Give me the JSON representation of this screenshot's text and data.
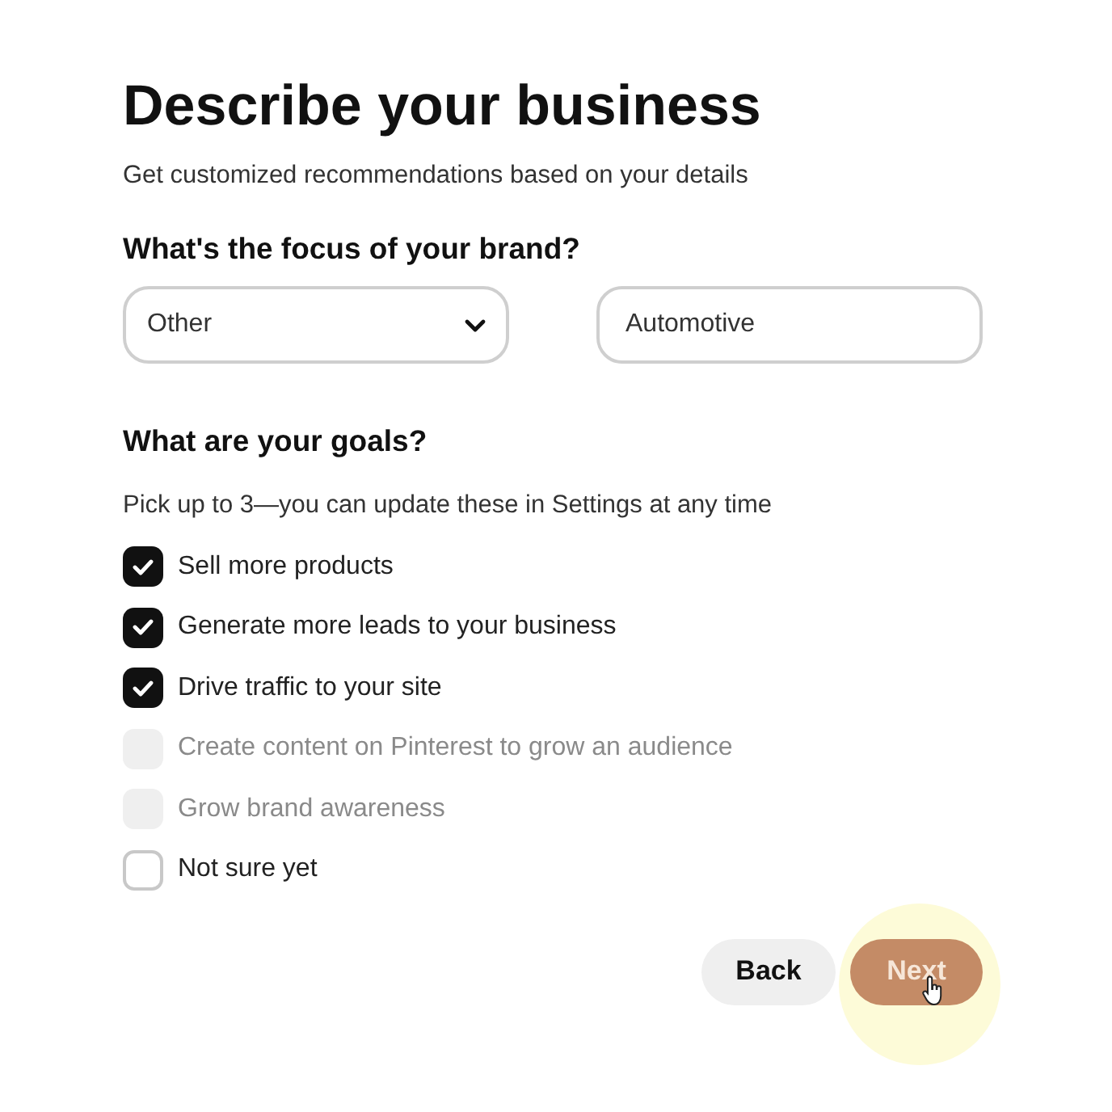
{
  "title": "Describe your business",
  "subtitle": "Get customized recommendations based on your details",
  "focus": {
    "heading": "What's the focus of your brand?",
    "fields": [
      {
        "kind": "dropdown",
        "value": "Other"
      },
      {
        "kind": "text",
        "value": "Automotive"
      }
    ]
  },
  "goals": {
    "heading": "What are your goals?",
    "hint": "Pick up to 3—you can update these in Settings at any time",
    "options": [
      {
        "label": "Sell more products",
        "checked": true,
        "disabled": false
      },
      {
        "label": "Generate more leads to your business",
        "checked": true,
        "disabled": false
      },
      {
        "label": "Drive traffic to your site",
        "checked": true,
        "disabled": false
      },
      {
        "label": "Create content on Pinterest to grow an audience",
        "checked": false,
        "disabled": true
      },
      {
        "label": "Grow brand awareness",
        "checked": false,
        "disabled": true
      },
      {
        "label": "Not sure yet",
        "checked": false,
        "disabled": false
      }
    ]
  },
  "buttons": [
    {
      "kind": "secondary",
      "label": "Back"
    },
    {
      "kind": "primary",
      "label": "Next",
      "hovered": true
    }
  ]
}
